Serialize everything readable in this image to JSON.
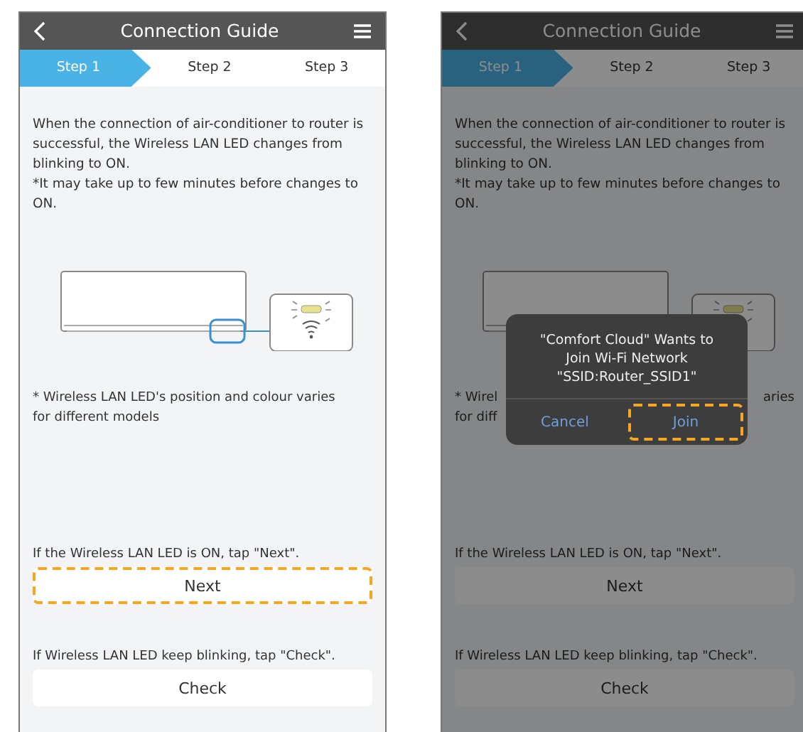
{
  "screens": [
    {
      "dimmed": false,
      "title": "Connection Guide",
      "steps": [
        {
          "label": "Step 1",
          "selected": true
        },
        {
          "label": "Step 2",
          "selected": false
        },
        {
          "label": "Step 3",
          "selected": false
        }
      ],
      "intro": "When the connection of air-conditioner to router is successful, the Wireless LAN LED changes from blinking to ON.",
      "note": "*It may take up to few minutes before changes to ON.",
      "footnote_lines": [
        [
          "* Wireless LAN LED's position and colour varies"
        ],
        [
          "for different models"
        ]
      ],
      "prompts": [
        {
          "text": "If the Wireless LAN LED is ON, tap \"Next\".",
          "button": "Next",
          "highlighted": true
        },
        {
          "text": "If Wireless LAN LED keep blinking, tap \"Check\".",
          "button": "Check",
          "highlighted": false
        }
      ]
    },
    {
      "dimmed": true,
      "title": "Connection Guide",
      "steps": [
        {
          "label": "Step 1",
          "selected": true
        },
        {
          "label": "Step 2",
          "selected": false
        },
        {
          "label": "Step 3",
          "selected": false
        }
      ],
      "intro": "When the connection of air-conditioner to router is successful, the Wireless LAN LED changes from blinking to ON.",
      "note": "*It may take up to few minutes before changes to ON.",
      "footnote_lines": [
        [
          "* Wirel",
          "aries"
        ],
        [
          "for diff"
        ]
      ],
      "prompts": [
        {
          "text": "If the Wireless LAN LED is ON, tap \"Next\".",
          "button": "Next",
          "highlighted": false
        },
        {
          "text": "If Wireless LAN LED keep blinking, tap \"Check\".",
          "button": "Check",
          "highlighted": false
        }
      ],
      "dialog": {
        "message_lines": [
          "\"Comfort Cloud\" Wants to",
          "Join Wi-Fi Network",
          "\"SSID:Router_SSID1\""
        ],
        "buttons": [
          {
            "label": "Cancel",
            "highlighted": false
          },
          {
            "label": "Join",
            "highlighted": true
          }
        ]
      }
    }
  ]
}
